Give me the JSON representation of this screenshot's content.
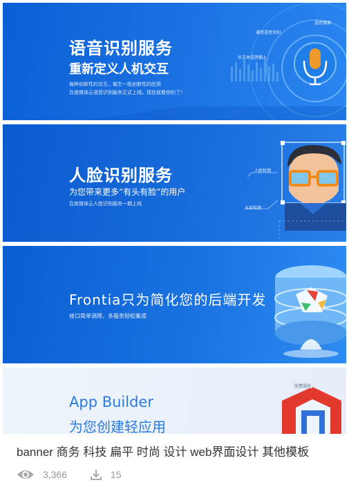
{
  "banners": {
    "b1": {
      "title": "语音识别服务",
      "subtitle": "重新定义人机交互",
      "line1": "每种创新性的交互，催生一批创新性的应用",
      "line2": "百度媒体云语音识别服务正式上线，现在就看你的了！",
      "tags": [
        "语音搜索",
        "通用语音识别",
        "长文本语音输入"
      ]
    },
    "b2": {
      "title": "人脸识别服务",
      "subtitle": "为您带来更多“有头有脸”的用户",
      "line1": "百度媒体云人脸识别服务一期上线",
      "tags": [
        "人脸检测",
        "五官检测"
      ]
    },
    "b3": {
      "title": "Frontia只为简化您的后端开发",
      "subtitle": "接口简单调用，多服务轻松集成"
    },
    "b4": {
      "title": "App Builder",
      "subtitle": "为您创建轻应用",
      "badge": "免费服务"
    }
  },
  "meta": {
    "tags_line": "banner 商务 科技 扁平 时尚 设计 web界面设计 其他模板",
    "views": "3,366",
    "downloads": "15"
  }
}
